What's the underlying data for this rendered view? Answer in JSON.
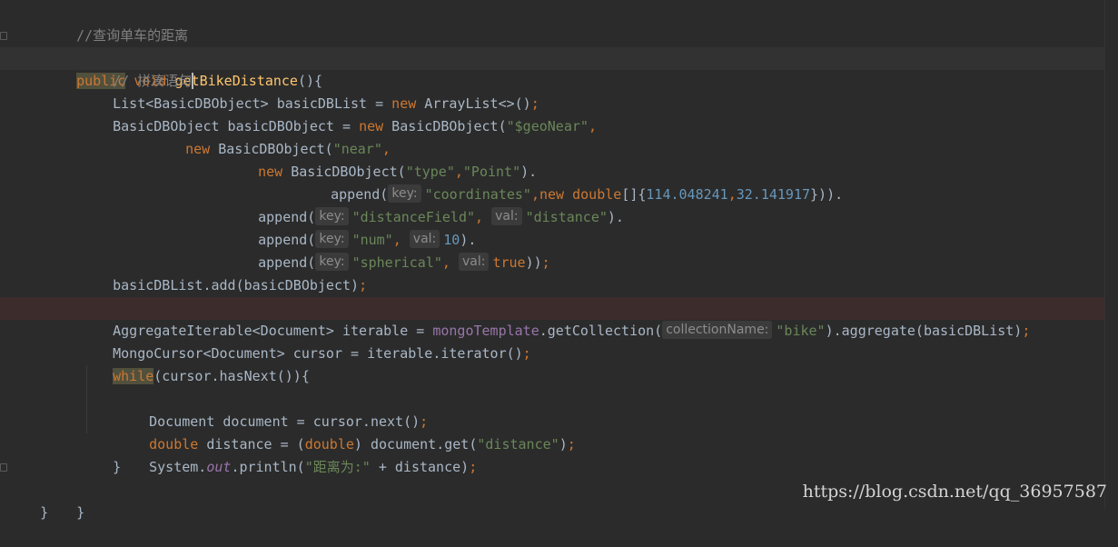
{
  "code": {
    "comment_header": "//查询单车的距离",
    "method_sig": {
      "kw_public": "public",
      "kw_void": "void",
      "name": "getBikeDistance",
      "rest": "(){"
    },
    "comment_concat": "// 拼凑语句",
    "line_list": {
      "type": "List<BasicDBObject> basicDBList = ",
      "kw_new": "new",
      "ctor": " ArrayList<>()",
      "semi": ";"
    },
    "line_obj": {
      "type": "BasicDBObject basicDBObject = ",
      "kw_new": "new",
      "ctor": " BasicDBObject(",
      "str": "\"$geoNear\"",
      "comma": ","
    },
    "line_near": {
      "kw_new": "new",
      "ctor": " BasicDBObject(",
      "str": "\"near\"",
      "comma": ","
    },
    "line_type": {
      "kw_new": "new",
      "ctor": " BasicDBObject(",
      "str1": "\"type\"",
      "comma": ",",
      "str2": "\"Point\"",
      "tail": ")."
    },
    "line_coords": {
      "call": "append(",
      "hint": "key:",
      "str": "\"coordinates\"",
      "comma": ",",
      "kw_new": "new",
      "kw_double": "double",
      "arr": "[]{",
      "num1": "114.048241",
      "comma2": ",",
      "num2": "32.141917",
      "tail": "}))."
    },
    "line_distfield": {
      "call": "append(",
      "hint_key": "key:",
      "str1": "\"distanceField\"",
      "comma": ",",
      "hint_val": "val:",
      "str2": "\"distance\"",
      "tail": ")."
    },
    "line_num": {
      "call": "append(",
      "hint_key": "key:",
      "str": "\"num\"",
      "comma": ",",
      "hint_val": "val:",
      "num": "10",
      "tail": ")."
    },
    "line_spherical": {
      "call": "append(",
      "hint_key": "key:",
      "str": "\"spherical\"",
      "comma": ",",
      "hint_val": "val:",
      "kw_true": "true",
      "tail": "))",
      "semi": ";"
    },
    "line_add": {
      "text": "basicDBList.add(basicDBObject)",
      "semi": ";"
    },
    "line_agg": {
      "type": "AggregateIterable<Document> iterable = ",
      "field": "mongoTemplate",
      "call": ".getCollection(",
      "hint": "collectionName:",
      "str": "\"bike\"",
      "tail": ").aggregate(basicDBList)",
      "semi": ";"
    },
    "line_cursor": {
      "text": "MongoCursor<Document> cursor = iterable.iterator()",
      "semi": ";"
    },
    "line_while": {
      "kw_while": "while",
      "rest": "(cursor.hasNext()){"
    },
    "line_doc": {
      "text": "Document document = cursor.next()",
      "semi": ";"
    },
    "line_distance": {
      "kw_double": "double",
      "mid": " distance = (",
      "kw_double2": "double",
      "mid2": ") document.get(",
      "str": "\"distance\"",
      "tail": ")",
      "semi": ";"
    },
    "line_print": {
      "head": "System.",
      "static": "out",
      "call": ".println(",
      "str": "\"距离为:\"",
      "tail": " + distance)",
      "semi": ";"
    },
    "close_while": "}",
    "close_method": "}",
    "close_class": "}"
  },
  "watermark": "https://blog.csdn.net/qq_36957587",
  "colors": {
    "background": "#2b2b2b",
    "keyword": "#cc7832",
    "string": "#6a8759",
    "number": "#6897bb",
    "method": "#ffc66d",
    "field": "#9876aa",
    "comment": "#808080"
  }
}
